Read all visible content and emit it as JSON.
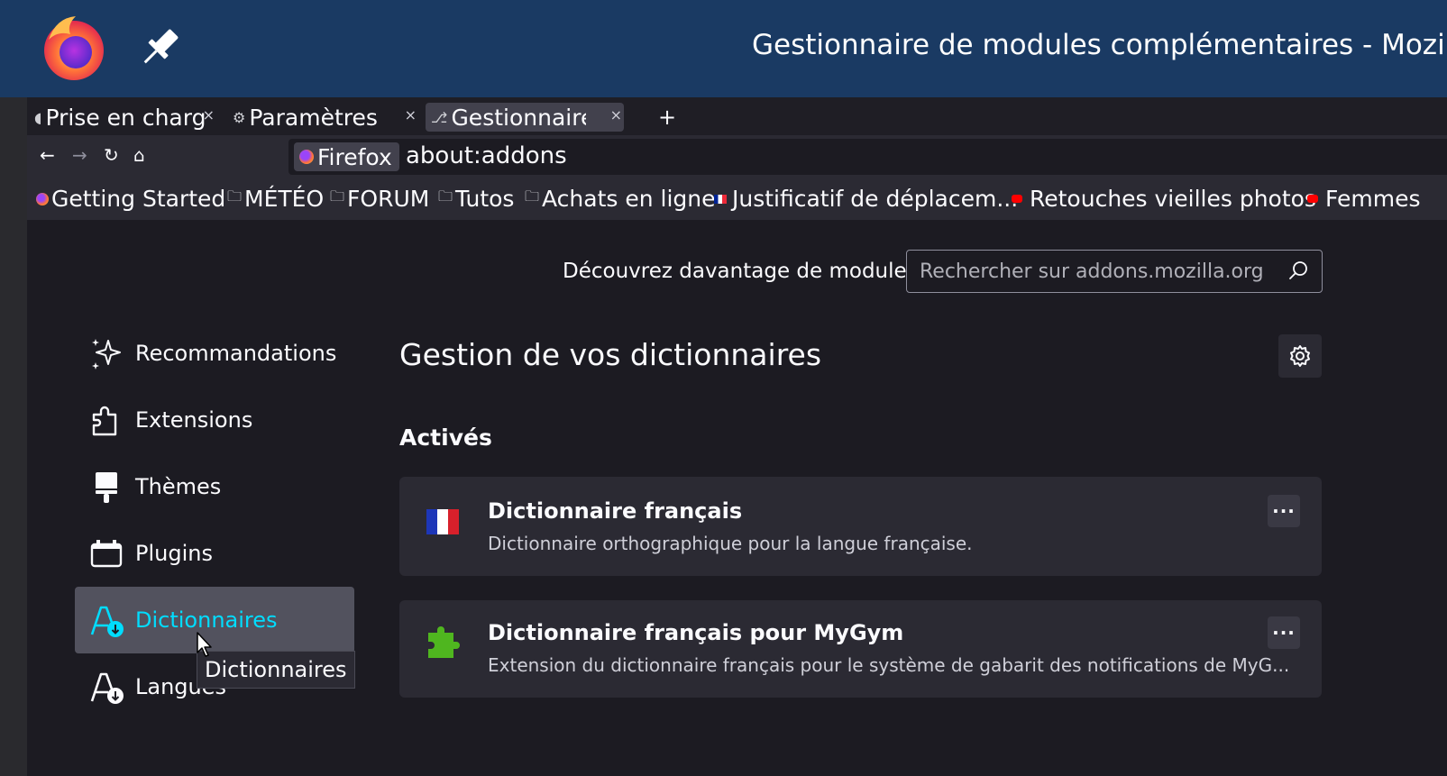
{
  "window": {
    "title": "Gestionnaire de modules complémentaires - Mozilla"
  },
  "tabs": [
    {
      "label": "Prise en charg",
      "icon": "help-icon"
    },
    {
      "label": "Paramètres",
      "icon": "gear-icon"
    },
    {
      "label": "Gestionnaire c",
      "icon": "puzzle-icon",
      "active": true
    }
  ],
  "urlbar": {
    "identity": "Firefox",
    "url": "about:addons"
  },
  "bookmarks": [
    {
      "label": "Getting Started",
      "icon": "firefox-icon"
    },
    {
      "label": "MÉTÉO",
      "icon": "folder-icon"
    },
    {
      "label": "FORUM",
      "icon": "folder-icon"
    },
    {
      "label": "Tutos",
      "icon": "folder-icon"
    },
    {
      "label": "Achats en ligne",
      "icon": "folder-icon"
    },
    {
      "label": "Justificatif de déplacem...",
      "icon": "flag-icon"
    },
    {
      "label": "Retouches vieilles photos",
      "icon": "youtube-icon"
    },
    {
      "label": "Femmes",
      "icon": "youtube-icon"
    }
  ],
  "header": {
    "discover_label": "Découvrez davantage de modules",
    "search_placeholder": "Rechercher sur addons.mozilla.org"
  },
  "sidebar": {
    "items": [
      {
        "label": "Recommandations",
        "icon": "sparkle-icon"
      },
      {
        "label": "Extensions",
        "icon": "puzzle-icon"
      },
      {
        "label": "Thèmes",
        "icon": "brush-icon"
      },
      {
        "label": "Plugins",
        "icon": "plugin-icon"
      },
      {
        "label": "Dictionnaires",
        "icon": "dictionary-icon",
        "selected": true
      },
      {
        "label": "Langues",
        "icon": "language-icon"
      }
    ],
    "tooltip": "Dictionnaires"
  },
  "main": {
    "heading": "Gestion de vos dictionnaires",
    "section_title": "Activés",
    "addons": [
      {
        "name": "Dictionnaire français",
        "description": "Dictionnaire orthographique pour la langue française.",
        "icon": "french-flag-icon"
      },
      {
        "name": "Dictionnaire français pour MyGym",
        "description": "Extension du dictionnaire français pour le système de gabarit des notifications de MyG...",
        "icon": "green-puzzle-icon"
      }
    ],
    "more_label": "···"
  },
  "colors": {
    "titlebar": "#1a3a63",
    "accent": "#00ddff",
    "background": "#1c1b22",
    "card": "#2b2a33"
  }
}
